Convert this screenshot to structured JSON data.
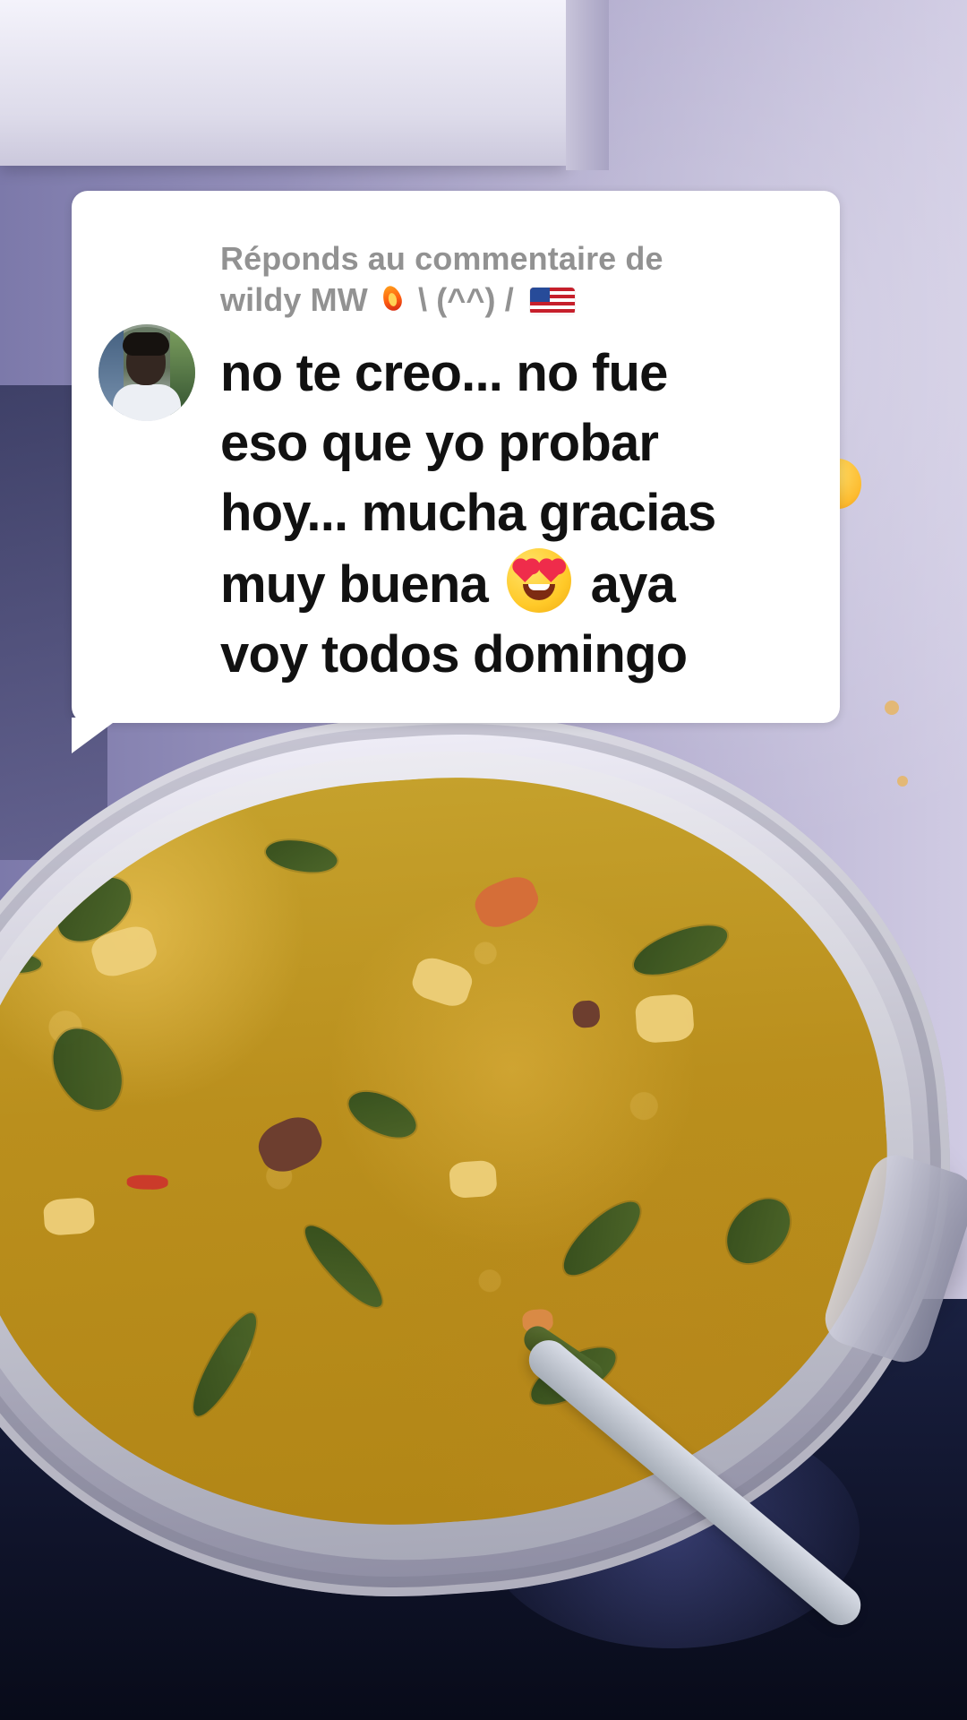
{
  "reply_card": {
    "label_prefix": "Réponds au commentaire de",
    "username": "wildy MW",
    "username_suffix": "\\ (^^) /",
    "icons": {
      "avatar": "profile-avatar",
      "fire": "fire-icon",
      "flag": "us-flag-icon",
      "emoji": "heart-eyes-icon"
    }
  },
  "comment": {
    "line1": "no te creo... no fue",
    "line2": "eso que yo probar",
    "line3": "hoy... mucha gracias",
    "line4_before_emoji": "muy buena",
    "line4_after_emoji": "aya",
    "line5": "voy todos domingo"
  },
  "colors": {
    "card_background": "#ffffff",
    "reply_text": "#929292",
    "comment_text": "#111111"
  }
}
